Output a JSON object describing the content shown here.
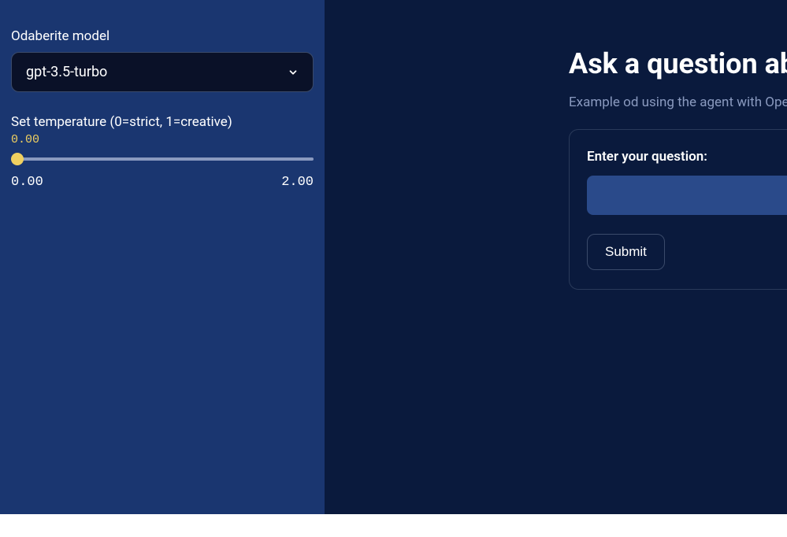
{
  "sidebar": {
    "model_label": "Odaberite model",
    "model_selected": "gpt-3.5-turbo",
    "temperature_label": "Set temperature (0=strict, 1=creative)",
    "temperature_value": "0.00",
    "temperature_min": "0.00",
    "temperature_max": "2.00"
  },
  "main": {
    "heading": "Ask a question abo",
    "subtitle": "Example od using the agent with Open",
    "form": {
      "question_label": "Enter your question:",
      "question_value": "",
      "submit_label": "Submit"
    }
  }
}
